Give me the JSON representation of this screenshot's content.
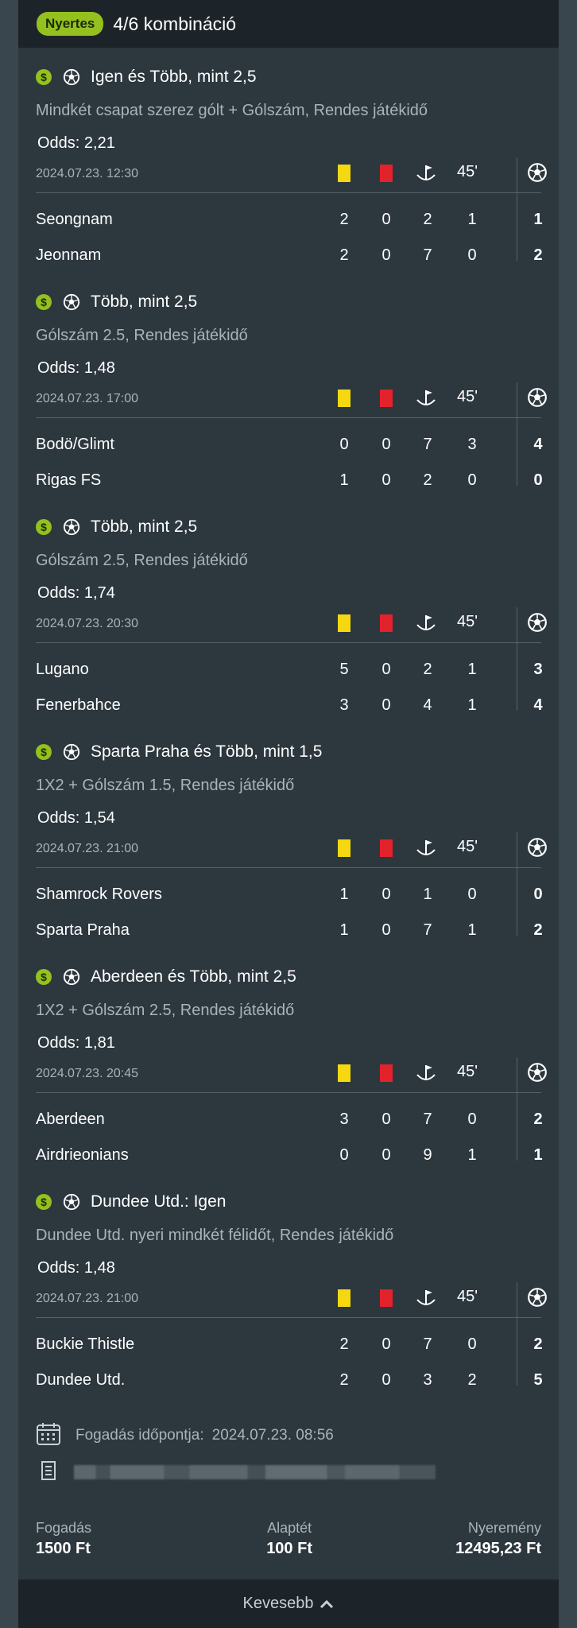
{
  "header": {
    "badge": "Nyertes",
    "title": "4/6 kombináció"
  },
  "colors": {
    "accent": "#94c11f",
    "yellow_card": "#f5d80f",
    "red_card": "#e3222b"
  },
  "icons": [
    "dollar-icon",
    "soccer-ball-icon",
    "yellow-card-icon",
    "red-card-icon",
    "corner-flag-icon",
    "calendar-icon",
    "ticket-id-icon",
    "chevron-up-icon"
  ],
  "stat_header": {
    "half": "45'"
  },
  "legs": [
    {
      "title": "Igen és Több, mint 2,5",
      "market": "Mindkét csapat szerez gólt + Gólszám, Rendes játékidő",
      "odds": "Odds: 2,21",
      "date": "2024.07.23. 12:30",
      "teams": [
        {
          "name": "Seongnam",
          "yellow": "2",
          "red": "0",
          "corners": "2",
          "half": "1",
          "goals": "1"
        },
        {
          "name": "Jeonnam",
          "yellow": "2",
          "red": "0",
          "corners": "7",
          "half": "0",
          "goals": "2"
        }
      ]
    },
    {
      "title": "Több, mint 2,5",
      "market": "Gólszám 2.5, Rendes játékidő",
      "odds": "Odds: 1,48",
      "date": "2024.07.23. 17:00",
      "teams": [
        {
          "name": "Bodö/Glimt",
          "yellow": "0",
          "red": "0",
          "corners": "7",
          "half": "3",
          "goals": "4"
        },
        {
          "name": "Rigas FS",
          "yellow": "1",
          "red": "0",
          "corners": "2",
          "half": "0",
          "goals": "0"
        }
      ]
    },
    {
      "title": "Több, mint 2,5",
      "market": "Gólszám 2.5, Rendes játékidő",
      "odds": "Odds: 1,74",
      "date": "2024.07.23. 20:30",
      "teams": [
        {
          "name": "Lugano",
          "yellow": "5",
          "red": "0",
          "corners": "2",
          "half": "1",
          "goals": "3"
        },
        {
          "name": "Fenerbahce",
          "yellow": "3",
          "red": "0",
          "corners": "4",
          "half": "1",
          "goals": "4"
        }
      ]
    },
    {
      "title": "Sparta Praha és Több, mint 1,5",
      "market": "1X2 + Gólszám 1.5, Rendes játékidő",
      "odds": "Odds: 1,54",
      "date": "2024.07.23. 21:00",
      "teams": [
        {
          "name": "Shamrock Rovers",
          "yellow": "1",
          "red": "0",
          "corners": "1",
          "half": "0",
          "goals": "0"
        },
        {
          "name": "Sparta Praha",
          "yellow": "1",
          "red": "0",
          "corners": "7",
          "half": "1",
          "goals": "2"
        }
      ]
    },
    {
      "title": "Aberdeen és Több, mint 2,5",
      "market": "1X2 + Gólszám 2.5, Rendes játékidő",
      "odds": "Odds: 1,81",
      "date": "2024.07.23. 20:45",
      "teams": [
        {
          "name": "Aberdeen",
          "yellow": "3",
          "red": "0",
          "corners": "7",
          "half": "0",
          "goals": "2"
        },
        {
          "name": "Airdrieonians",
          "yellow": "0",
          "red": "0",
          "corners": "9",
          "half": "1",
          "goals": "1"
        }
      ]
    },
    {
      "title": "Dundee Utd.: Igen",
      "market": "Dundee Utd. nyeri mindkét félidőt, Rendes játékidő",
      "odds": "Odds: 1,48",
      "date": "2024.07.23. 21:00",
      "teams": [
        {
          "name": "Buckie Thistle",
          "yellow": "2",
          "red": "0",
          "corners": "7",
          "half": "0",
          "goals": "2"
        },
        {
          "name": "Dundee Utd.",
          "yellow": "2",
          "red": "0",
          "corners": "3",
          "half": "2",
          "goals": "5"
        }
      ]
    }
  ],
  "bet_time": {
    "label": "Fogadás időpontja:",
    "value": "2024.07.23. 08:56"
  },
  "totals": {
    "stake_label": "Fogadás",
    "stake_value": "1500 Ft",
    "base_label": "Alaptét",
    "base_value": "100 Ft",
    "win_label": "Nyeremény",
    "win_value": "12495,23 Ft"
  },
  "footer": {
    "less_label": "Kevesebb"
  }
}
